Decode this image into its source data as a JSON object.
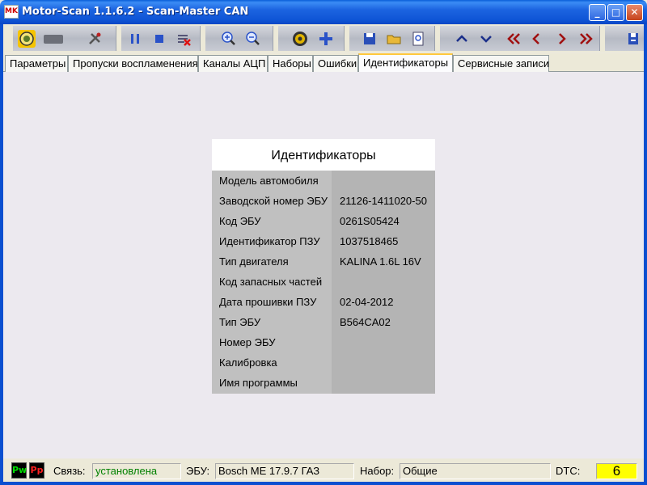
{
  "window": {
    "logo": "MK",
    "title": "Motor-Scan 1.1.6.2 - Scan-Master CAN",
    "minimize": "_",
    "maximize": "□",
    "close": "✕"
  },
  "toolbar": {
    "icons": [
      "connect-icon",
      "device-icon",
      "settings-tools-icon",
      "pause-icon",
      "stop-icon",
      "clear-errors-icon",
      "zoom-in-icon",
      "zoom-out-icon",
      "gear-icon",
      "add-icon",
      "save-icon",
      "open-folder-icon",
      "print-preview-icon",
      "arrow-up-icon",
      "arrow-down-icon",
      "first-icon",
      "previous-icon",
      "next-icon",
      "last-icon",
      "exit-icon"
    ]
  },
  "tabs": [
    {
      "label": "Параметры"
    },
    {
      "label": "Пропуски воспламенения"
    },
    {
      "label": "Каналы АЦП"
    },
    {
      "label": "Наборы"
    },
    {
      "label": "Ошибки"
    },
    {
      "label": "Идентификаторы"
    },
    {
      "label": "Сервисные записи"
    }
  ],
  "active_tab": "Идентификаторы",
  "identifiers": {
    "title": "Идентификаторы",
    "rows": [
      {
        "label": "Модель автомобиля",
        "value": ""
      },
      {
        "label": "Заводской номер ЭБУ",
        "value": "21126-1411020-50"
      },
      {
        "label": "Код ЭБУ",
        "value": "0261S05424"
      },
      {
        "label": "Идентификатор ПЗУ",
        "value": "1037518465"
      },
      {
        "label": "Тип двигателя",
        "value": "KALINA 1.6L 16V"
      },
      {
        "label": "Код запасных частей",
        "value": ""
      },
      {
        "label": "Дата прошивки ПЗУ",
        "value": "02-04-2012"
      },
      {
        "label": "Тип ЭБУ",
        "value": "B564CA02"
      },
      {
        "label": "Номер ЭБУ",
        "value": ""
      },
      {
        "label": "Калибровка",
        "value": ""
      },
      {
        "label": "Имя программы",
        "value": ""
      }
    ]
  },
  "status": {
    "pw_indicator": "Pw",
    "pp_indicator": "Pp",
    "connection_label": "Связь:",
    "connection_value": "установлена",
    "ecu_label": "ЭБУ:",
    "ecu_value": "Bosch ME 17.9.7 ГАЗ",
    "set_label": "Набор:",
    "set_value": "Общие",
    "dtc_label": "DTC:",
    "dtc_value": "6"
  },
  "colors": {
    "title_bar": "#0f55d6",
    "connection_ok": "#008000",
    "dtc_highlight": "#ffff00"
  }
}
